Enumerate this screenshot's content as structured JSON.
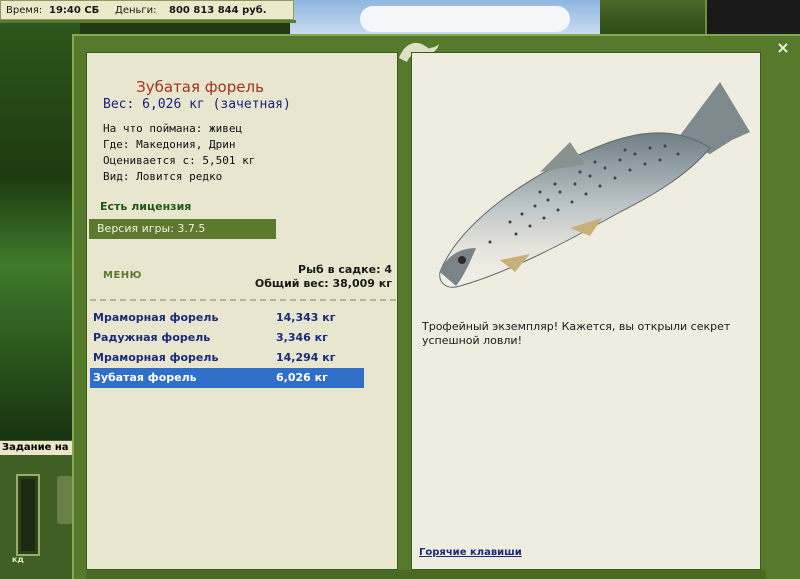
{
  "status_bar": {
    "time_label": "Время:",
    "time_value": "19:40 СБ",
    "money_label": "Деньги:",
    "money_value": "800 813 844 руб."
  },
  "side": {
    "task_label": "Задание на тур",
    "gauge_label": "кд"
  },
  "fish": {
    "name": "Зубатая форель",
    "weight": "Вес: 6,026 кг (зачетная)",
    "details": [
      "На что поймана: живец",
      "Где: Македония, Дрин",
      "Оценивается с: 5,501 кг",
      "Вид: Ловится редко"
    ],
    "description": "Трофейный экземпляр! Кажется, вы открыли секрет успешной ловли!"
  },
  "license_text": "Есть лицензия",
  "version_text": "Версия игры: 3.7.5",
  "menu_label": "МЕНЮ",
  "cage": {
    "count": "Рыб в садке: 4",
    "total": "Общий вес: 38,009 кг"
  },
  "catch_list": [
    {
      "name": "Мраморная форель",
      "weight": "14,343 кг",
      "selected": false
    },
    {
      "name": "Радужная форель",
      "weight": "3,346 кг",
      "selected": false
    },
    {
      "name": "Мраморная форель",
      "weight": "14,294 кг",
      "selected": false
    },
    {
      "name": "Зубатая форель",
      "weight": "6,026 кг",
      "selected": true
    }
  ],
  "hotkeys_label": "Горячие клавиши",
  "close_glyph": "×",
  "colors": {
    "frame_green": "#557a2c",
    "panel_bg": "#e9e6d0",
    "title_red": "#a4331a",
    "selected_blue": "#2f6fc9"
  }
}
